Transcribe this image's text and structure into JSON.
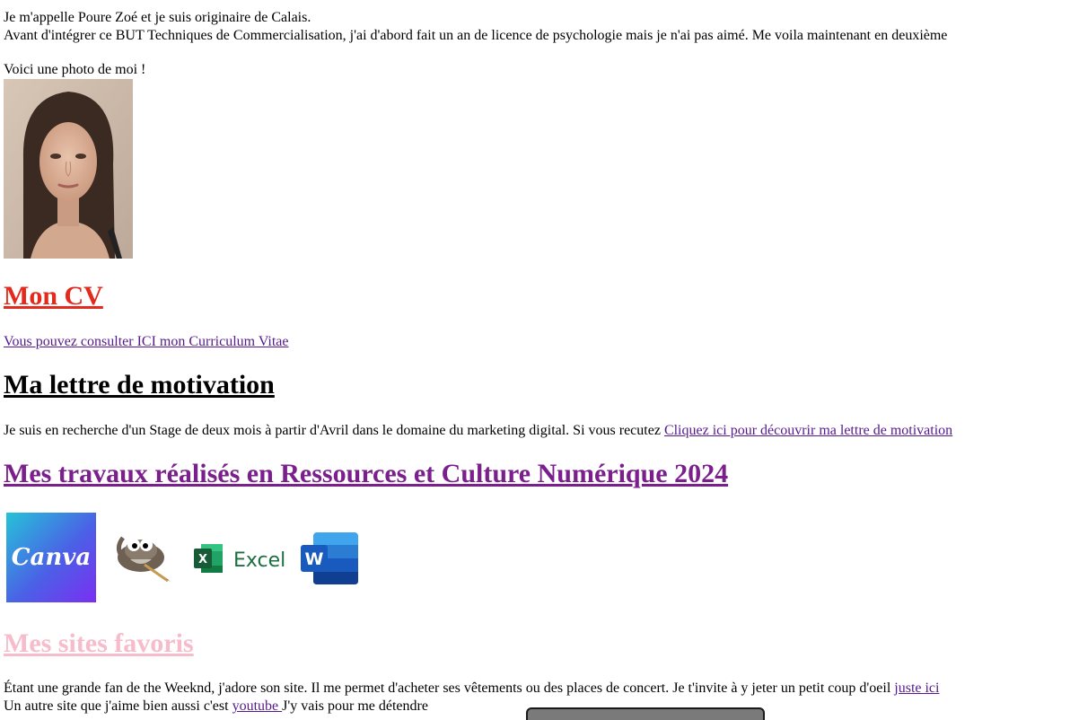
{
  "intro": {
    "line1": "Je m'appelle Poure Zoé et je suis originaire de Calais.",
    "line2": "Avant d'intégrer ce BUT Techniques de Commercialisation, j'ai d'abord fait un an de licence de psychologie mais je n'ai pas aimé. Me voila maintenant en deuxième"
  },
  "photo": {
    "caption": "Voici une photo de moi !"
  },
  "cv": {
    "heading": "Mon CV",
    "link_label": "Vous pouvez consulter ICI mon Curriculum Vitae",
    "heading_color": "#e32a1c"
  },
  "lettre": {
    "heading": "Ma lettre de motivation",
    "text": "Je suis en recherche d'un Stage de deux mois à partir d'Avril dans le domaine du marketing digital. Si vous recutez ",
    "link_label": "Cliquez ici pour découvrir ma lettre de motivation"
  },
  "travaux": {
    "heading": "Mes travaux réalisés en Ressources et Culture Numérique 2024",
    "heading_color": "#7a1f8c",
    "logos": [
      {
        "name": "canva-logo",
        "label": "Canva"
      },
      {
        "name": "gimp-logo",
        "label": ""
      },
      {
        "name": "excel-logo",
        "label": "Excel"
      },
      {
        "name": "word-logo",
        "label": "W"
      }
    ]
  },
  "sites": {
    "heading": "Mes sites favoris",
    "heading_color": "#f7bccb",
    "text1": "Étant une grande fan de the Weeknd, j'adore son site. Il me permet d'acheter ses vêtements ou des places de concert. Je t'invite à y jeter un petit coup d'oeil ",
    "link1": "juste ici",
    "text2_before": "Un autre site que j'aime bien aussi c'est ",
    "link2": "youtube ",
    "text2_after": "J'y vais pour me détendre"
  }
}
